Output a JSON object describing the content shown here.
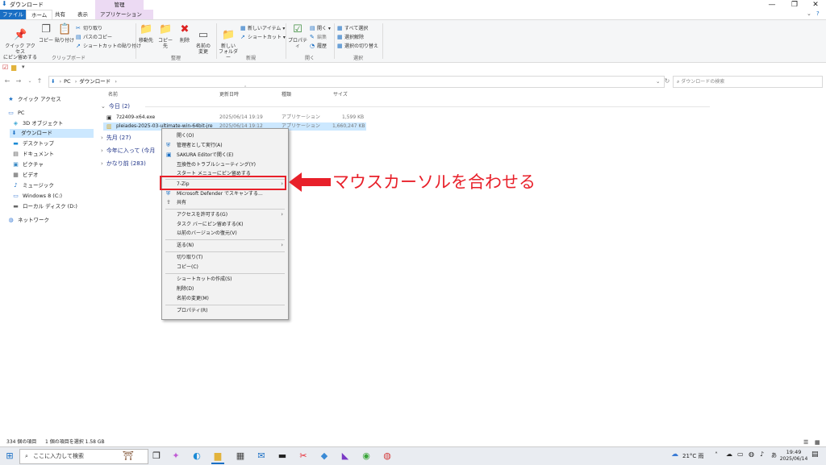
{
  "window": {
    "title": "ダウンロード",
    "controls": [
      "—",
      "❐",
      "✕"
    ]
  },
  "tabs": {
    "file": "ファイル",
    "home": "ホーム",
    "share": "共有",
    "view": "表示",
    "manage": "管理",
    "app_tools": "アプリケーション ツール"
  },
  "ribbon": {
    "pin_quick": "クイック アクセス\nにピン留めする",
    "copy": "コピー",
    "paste": "貼り付け",
    "cut": "切り取り",
    "copy_path": "パスのコピー",
    "paste_shortcut": "ショートカットの貼り付け",
    "clipboard_group": "クリップボード",
    "move_to": "移動先",
    "copy_to": "コピー先",
    "delete": "削除",
    "rename": "名前の\n変更",
    "organize_group": "整理",
    "new_folder": "新しい\nフォルダー",
    "new_item": "新しいアイテム",
    "shortcut": "ショートカット",
    "new_group": "新規",
    "properties": "プロパティ",
    "open": "開く",
    "edit": "編集",
    "history": "履歴",
    "open_group": "開く",
    "select_all": "すべて選択",
    "select_none": "選択解除",
    "invert": "選択の切り替え",
    "select_group": "選択"
  },
  "address": {
    "path_pc": "PC",
    "path_folder": "ダウンロード",
    "search_placeholder": "ダウンロードの検索"
  },
  "sidebar": {
    "items": [
      {
        "label": "クイック アクセス",
        "icon": "star-icon"
      },
      {
        "label": "PC",
        "icon": "pc-icon"
      },
      {
        "label": "3D オブジェクト",
        "icon": "cube-icon"
      },
      {
        "label": "ダウンロード",
        "icon": "download-icon"
      },
      {
        "label": "デスクトップ",
        "icon": "desktop-icon"
      },
      {
        "label": "ドキュメント",
        "icon": "document-icon"
      },
      {
        "label": "ピクチャ",
        "icon": "picture-icon"
      },
      {
        "label": "ビデオ",
        "icon": "video-icon"
      },
      {
        "label": "ミュージック",
        "icon": "music-icon"
      },
      {
        "label": "Windows 8 (C:)",
        "icon": "drive-icon"
      },
      {
        "label": "ローカル ディスク (D:)",
        "icon": "drive-icon"
      },
      {
        "label": "ネットワーク",
        "icon": "network-icon"
      }
    ]
  },
  "columns": {
    "name": "名前",
    "date": "更新日時",
    "type": "種類",
    "size": "サイズ"
  },
  "groups": {
    "today": "今日 (2)",
    "last_month": "先月 (27)",
    "this_year": "今年に入って (今月",
    "long_ago": "かなり前 (283)"
  },
  "files": [
    {
      "name": "7z2409-x64.exe",
      "date": "2025/06/14 19:19",
      "type": "アプリケーション",
      "size": "1,599 KB"
    },
    {
      "name": "pleiades-2025-03-ultimate-win-64bit-jre_...",
      "date": "2025/06/14 19:12",
      "type": "アプリケーション",
      "size": "1,660,247 KB"
    }
  ],
  "context_menu": {
    "items": [
      {
        "label": "開く(O)",
        "icon": "",
        "submenu": false
      },
      {
        "label": "管理者として実行(A)",
        "icon": "shield-icon",
        "submenu": false
      },
      {
        "label": "SAKURA Editorで開く(E)",
        "icon": "sakura-icon",
        "submenu": false
      },
      {
        "label": "互換性のトラブルシューティング(Y)",
        "icon": "",
        "submenu": false
      },
      {
        "label": "スタート メニューにピン留めする",
        "icon": "",
        "submenu": false
      },
      {
        "label": "7-Zip",
        "icon": "",
        "submenu": true
      },
      {
        "label": "Microsoft Defender でスキャンする...",
        "icon": "defender-icon",
        "submenu": false
      },
      {
        "label": "共有",
        "icon": "share-icon",
        "submenu": false
      },
      {
        "label": "アクセスを許可する(G)",
        "icon": "",
        "submenu": true
      },
      {
        "label": "タスク バーにピン留めする(K)",
        "icon": "",
        "submenu": false
      },
      {
        "label": "以前のバージョンの復元(V)",
        "icon": "",
        "submenu": false
      },
      {
        "label": "送る(N)",
        "icon": "",
        "submenu": true
      },
      {
        "label": "切り取り(T)",
        "icon": "",
        "submenu": false
      },
      {
        "label": "コピー(C)",
        "icon": "",
        "submenu": false
      },
      {
        "label": "ショートカットの作成(S)",
        "icon": "",
        "submenu": false
      },
      {
        "label": "削除(D)",
        "icon": "",
        "submenu": false
      },
      {
        "label": "名前の変更(M)",
        "icon": "",
        "submenu": false
      },
      {
        "label": "プロパティ(R)",
        "icon": "",
        "submenu": false
      }
    ]
  },
  "callout": {
    "text": "マウスカーソルを合わせる",
    "color": "#e8202a"
  },
  "status": {
    "count": "334 個の項目",
    "selected": "1 個の項目を選択  1.58 GB"
  },
  "taskbar": {
    "search_placeholder": "ここに入力して検索",
    "weather": "21°C 雨",
    "ime": "あ",
    "time": "19:49",
    "date": "2025/06/14"
  }
}
